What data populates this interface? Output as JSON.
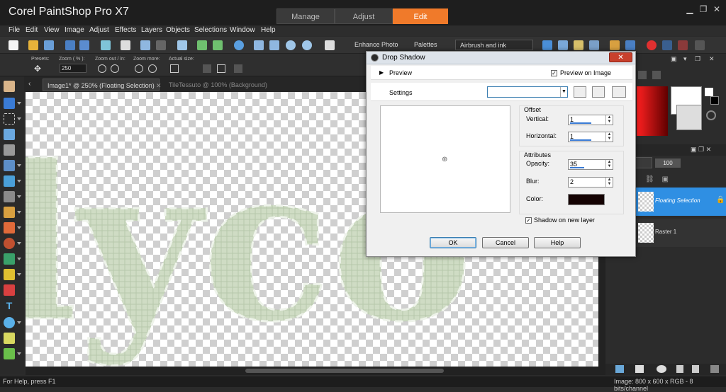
{
  "app": {
    "title": "Corel PaintShop Pro X7"
  },
  "mode_tabs": [
    {
      "label": "Manage"
    },
    {
      "label": "Adjust"
    },
    {
      "label": "Edit"
    }
  ],
  "menu": [
    "File",
    "Edit",
    "View",
    "Image",
    "Adjust",
    "Effects",
    "Layers",
    "Objects",
    "Selections",
    "Window",
    "Help"
  ],
  "toolbar": {
    "enhance_photo": "Enhance Photo",
    "palettes": "Palettes",
    "workspace": "Airbrush and ink"
  },
  "tool_options": {
    "presets_label": "Presets:",
    "zoom_label": "Zoom ( % ):",
    "zoom_value": "250",
    "zoom_out_in_label": "Zoom out / in:",
    "zoom_more_label": "Zoom more:",
    "actual_size_label": "Actual size:"
  },
  "doc_tabs": [
    {
      "label": "Image1* @ 250% (Floating Selection)"
    },
    {
      "label": "TileTessuto @ 100% (Background)"
    }
  ],
  "canvas_text": "lyco",
  "layers": {
    "opacity": "100",
    "items": [
      {
        "name": "Floating Selection"
      },
      {
        "name": "Raster 1"
      }
    ]
  },
  "dialog": {
    "title": "Drop Shadow",
    "close": "✕",
    "preview_label": "Preview",
    "preview_on_image_label": "Preview on Image",
    "settings_label": "Settings",
    "offset_group": "Offset",
    "vertical_label": "Vertical:",
    "vertical_value": "1",
    "horizontal_label": "Horizontal:",
    "horizontal_value": "1",
    "attributes_group": "Attributes",
    "opacity_label": "Opacity:",
    "opacity_value": "35",
    "blur_label": "Blur:",
    "blur_value": "2",
    "color_label": "Color:",
    "shadow_color": "#140202",
    "shadow_new_layer_label": "Shadow on new layer",
    "ok": "OK",
    "cancel": "Cancel",
    "help": "Help"
  },
  "status": {
    "help": "For Help, press F1",
    "info": "Image:  800 x 600 x RGB - 8 bits/channel"
  },
  "colors": {
    "accent": "#f07a2a",
    "selection": "#2f8fe3",
    "letters": "#cfdcc4"
  }
}
